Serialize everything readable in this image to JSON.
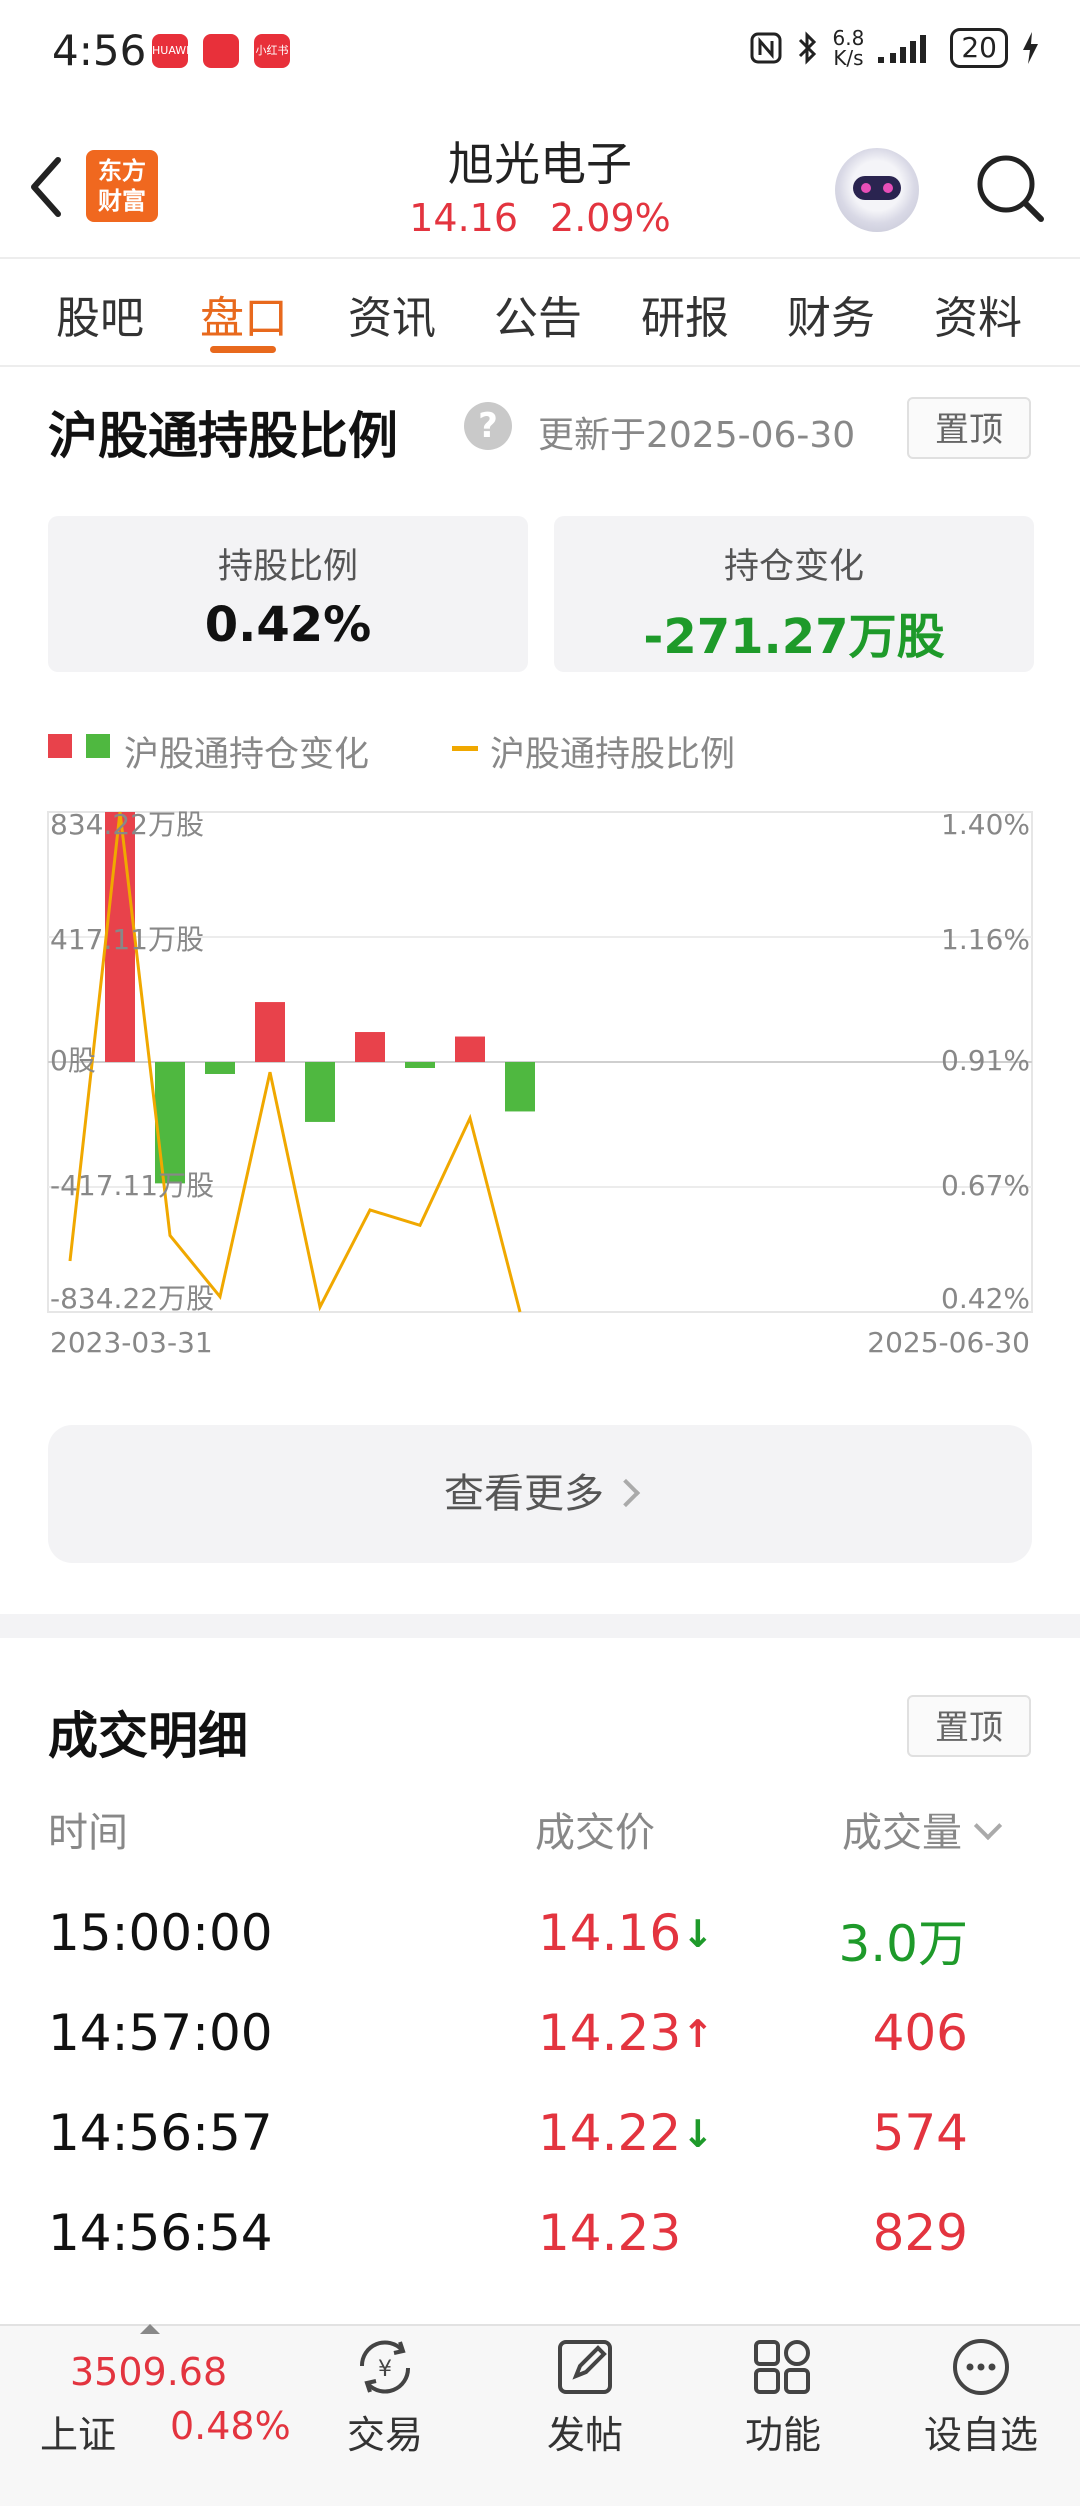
{
  "status_bar": {
    "time": "4:56",
    "apps": [
      "HUAWEI",
      "",
      "小红书"
    ],
    "net_speed_top": "6.8",
    "net_speed_unit": "K/s",
    "battery": "20"
  },
  "header": {
    "logo_line1": "东方",
    "logo_line2": "财富",
    "stock_name": "旭光电子",
    "price": "14.16",
    "change_pct": "2.09%"
  },
  "tabs": [
    "股吧",
    "盘口",
    "资讯",
    "公告",
    "研报",
    "财务",
    "资料"
  ],
  "active_tab": "盘口",
  "holding": {
    "title": "沪股通持股比例",
    "help": "?",
    "updated": "更新于2025-06-30",
    "pin": "置顶",
    "card1_label": "持股比例",
    "card1_value": "0.42%",
    "card2_label": "持仓变化",
    "card2_value": "-271.27万股",
    "legend_bar": "沪股通持仓变化",
    "legend_line": "沪股通持股比例",
    "more": "查看更多"
  },
  "chart_data": {
    "type": "bar",
    "series": [
      {
        "name": "沪股通持仓变化",
        "values": [
          834.22,
          -405,
          -40,
          200,
          -200,
          100,
          -20,
          85,
          -165
        ],
        "colors": {
          "positive": "#e8424b",
          "negative": "#4fb840"
        }
      },
      {
        "name": "沪股通持股比例",
        "values": [
          0.52,
          1.4,
          0.57,
          0.45,
          0.89,
          0.43,
          0.62,
          0.59,
          0.8,
          0.42
        ]
      }
    ],
    "y_left_ticks": [
      "834.22万股",
      "417.11万股",
      "0股",
      "-417.11万股",
      "-834.22万股"
    ],
    "y_right_ticks": [
      "1.40%",
      "1.16%",
      "0.91%",
      "0.67%",
      "0.42%"
    ],
    "ylim_left": [
      -834.22,
      834.22
    ],
    "ylim_right": [
      0.42,
      1.4
    ],
    "x_start": "2023-03-31",
    "x_end": "2025-06-30",
    "grid": true
  },
  "trades": {
    "title": "成交明细",
    "pin": "置顶",
    "col_time": "时间",
    "col_price": "成交价",
    "col_volume": "成交量",
    "rows": [
      {
        "time": "15:00:00",
        "price": "14.16",
        "arrow": "↓",
        "dir": "down",
        "volume": "3.0万",
        "vol_dir": "down"
      },
      {
        "time": "14:57:00",
        "price": "14.23",
        "arrow": "↑",
        "dir": "up",
        "volume": "406",
        "vol_dir": "up"
      },
      {
        "time": "14:56:57",
        "price": "14.22",
        "arrow": "↓",
        "dir": "down",
        "volume": "574",
        "vol_dir": "up"
      },
      {
        "time": "14:56:54",
        "price": "14.23",
        "arrow": "",
        "dir": "up",
        "volume": "829",
        "vol_dir": "up"
      }
    ]
  },
  "bottom_bar": {
    "index_value": "3509.68",
    "index_name": "上证",
    "index_pct": "0.48%",
    "nav": [
      "交易",
      "发帖",
      "功能",
      "设自选"
    ]
  }
}
